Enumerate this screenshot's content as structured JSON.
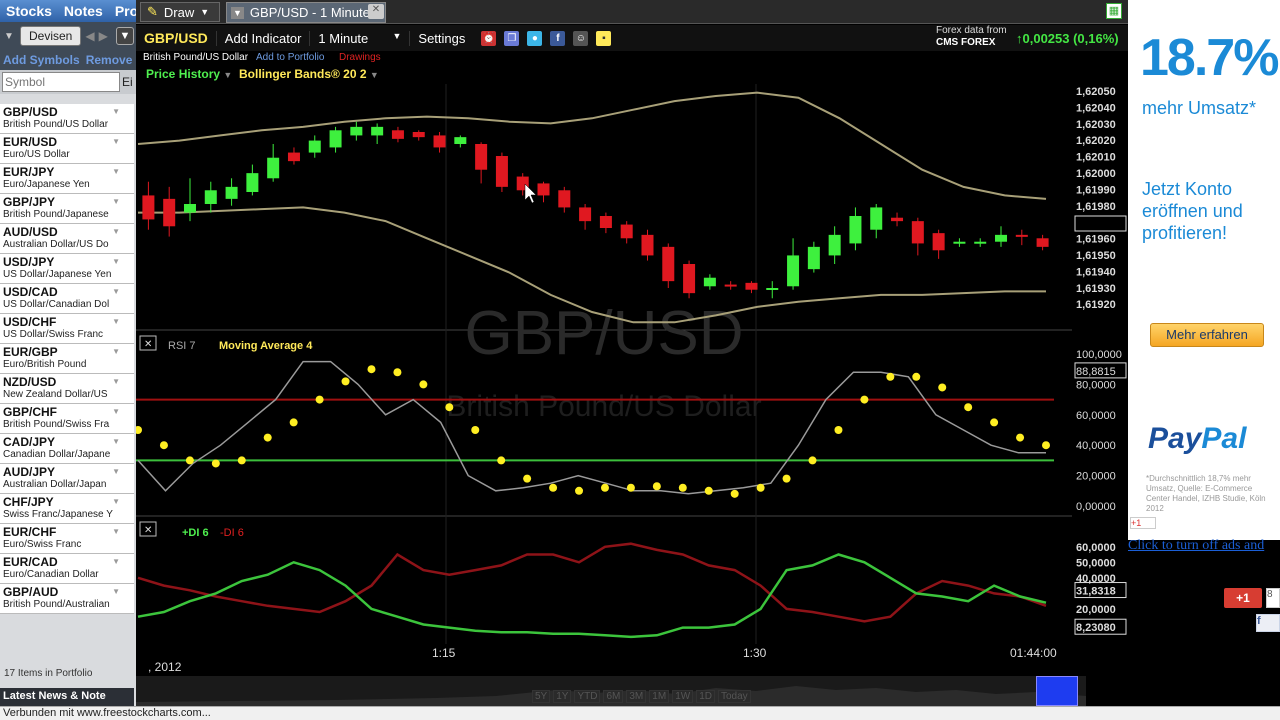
{
  "sidebar": {
    "tabs": [
      "Stocks",
      "Notes",
      "Prof"
    ],
    "devisen_label": "Devisen",
    "add_symbols": "Add Symbols",
    "remove": "Remove",
    "symbol_placeholder": "Symbol",
    "symbol_ed": "Ei",
    "items": [
      {
        "code": "GBP/USD",
        "name": "British Pound/US Dollar"
      },
      {
        "code": "EUR/USD",
        "name": "Euro/US Dollar"
      },
      {
        "code": "EUR/JPY",
        "name": "Euro/Japanese Yen"
      },
      {
        "code": "GBP/JPY",
        "name": "British Pound/Japanese"
      },
      {
        "code": "AUD/USD",
        "name": "Australian Dollar/US Do"
      },
      {
        "code": "USD/JPY",
        "name": "US Dollar/Japanese Yen"
      },
      {
        "code": "USD/CAD",
        "name": "US Dollar/Canadian Dol"
      },
      {
        "code": "USD/CHF",
        "name": "US Dollar/Swiss Franc"
      },
      {
        "code": "EUR/GBP",
        "name": "Euro/British Pound"
      },
      {
        "code": "NZD/USD",
        "name": "New Zealand Dollar/US"
      },
      {
        "code": "GBP/CHF",
        "name": "British Pound/Swiss Fra"
      },
      {
        "code": "CAD/JPY",
        "name": "Canadian Dollar/Japane"
      },
      {
        "code": "AUD/JPY",
        "name": "Australian Dollar/Japan"
      },
      {
        "code": "CHF/JPY",
        "name": "Swiss Franc/Japanese Y"
      },
      {
        "code": "EUR/CHF",
        "name": "Euro/Swiss Franc"
      },
      {
        "code": "EUR/CAD",
        "name": "Euro/Canadian Dollar"
      },
      {
        "code": "GBP/AUD",
        "name": "British Pound/Australian"
      }
    ],
    "items_count": "17 Items in Portfolio",
    "latest_news": "Latest News & Note"
  },
  "topbar": {
    "draw": "Draw",
    "tab_title": "GBP/USD - 1 Minute"
  },
  "toolbar": {
    "symbol": "GBP/USD",
    "add_indicator": "Add Indicator",
    "interval": "1 Minute",
    "settings": "Settings",
    "forex_data": "Forex data from",
    "cms_forex": "CMS FOREX",
    "change": "0,00253 (0,16%)"
  },
  "subtitle": {
    "name": "British Pound/US Dollar",
    "add_portfolio": "Add to Portfolio",
    "drawings": "Drawings"
  },
  "indicators": {
    "price_history": "Price History",
    "bollinger": "Bollinger Bands® 20 2",
    "rsi": "RSI 7",
    "moving_avg": "Moving Average 4",
    "di_plus": "+DI 6",
    "di_minus": "-DI 6"
  },
  "watermark": {
    "symbol": "GBP/USD",
    "name": "British Pound/US Dollar"
  },
  "price_axis": [
    "1,62050",
    "1,62040",
    "1,62030",
    "1,62020",
    "1,62010",
    "1,62000",
    "1,61990",
    "1,61980",
    "1,61970",
    "1,61960",
    "1,61950",
    "1,61940",
    "1,61930",
    "1,61920"
  ],
  "rsi_axis": [
    "100,0000",
    "88,8815",
    "80,0000",
    "60,0000",
    "40,0000",
    "20,0000",
    "0,00000"
  ],
  "di_axis": [
    "60,0000",
    "50,0000",
    "40,0000",
    "31,8318",
    "20,0000",
    "8,23080"
  ],
  "time_axis": [
    "1:15",
    "1:30",
    "01:44:00"
  ],
  "date_label": ", 2012",
  "range_buttons": [
    "5Y",
    "1Y",
    "YTD",
    "6M",
    "3M",
    "1M",
    "1W",
    "1D",
    "Today"
  ],
  "ad": {
    "percent": "18.7%",
    "mehr": "mehr Umsatz*",
    "konto": "Jetzt Konto eröffnen und profitieren!",
    "button": "Mehr erfahren",
    "paypal_a": "Pay",
    "paypal_b": "Pal",
    "fine": "*Durchschnittlich 18,7% mehr Umsatz, Quelle: E-Commerce Center Handel, IZHB Studie, Köln 2012",
    "turn_off": "Click to turn off ads and"
  },
  "social": {
    "gplus_small": "+1",
    "gplus": "+1",
    "gplus_count": "8",
    "fb": "f"
  },
  "status": "Verbunden mit www.freestockcharts.com...",
  "chart_data": {
    "type": "line",
    "candles": [
      {
        "o": 1.61976,
        "c": 1.6199,
        "h": 1.61998,
        "l": 1.6197,
        "up": false
      },
      {
        "o": 1.61972,
        "c": 1.61988,
        "h": 1.61995,
        "l": 1.61966,
        "up": false
      },
      {
        "o": 1.61985,
        "c": 1.6198,
        "h": 1.62,
        "l": 1.61975,
        "up": true
      },
      {
        "o": 1.61985,
        "c": 1.61993,
        "h": 1.61998,
        "l": 1.6198,
        "up": true
      },
      {
        "o": 1.61988,
        "c": 1.61995,
        "h": 1.62,
        "l": 1.61984,
        "up": true
      },
      {
        "o": 1.61992,
        "c": 1.62003,
        "h": 1.62008,
        "l": 1.6199,
        "up": true
      },
      {
        "o": 1.62,
        "c": 1.62012,
        "h": 1.6202,
        "l": 1.61998,
        "up": true
      },
      {
        "o": 1.62015,
        "c": 1.6201,
        "h": 1.62018,
        "l": 1.62008,
        "up": false
      },
      {
        "o": 1.62015,
        "c": 1.62022,
        "h": 1.62025,
        "l": 1.62012,
        "up": true
      },
      {
        "o": 1.62018,
        "c": 1.62028,
        "h": 1.6203,
        "l": 1.62015,
        "up": true
      },
      {
        "o": 1.62025,
        "c": 1.6203,
        "h": 1.62033,
        "l": 1.62022,
        "up": true
      },
      {
        "o": 1.62025,
        "c": 1.6203,
        "h": 1.62032,
        "l": 1.6202,
        "up": true
      },
      {
        "o": 1.62028,
        "c": 1.62023,
        "h": 1.6203,
        "l": 1.62021,
        "up": false
      },
      {
        "o": 1.62027,
        "c": 1.62024,
        "h": 1.62028,
        "l": 1.62022,
        "up": false
      },
      {
        "o": 1.62025,
        "c": 1.62018,
        "h": 1.62027,
        "l": 1.62015,
        "up": false
      },
      {
        "o": 1.6202,
        "c": 1.62024,
        "h": 1.62025,
        "l": 1.62018,
        "up": true
      },
      {
        "o": 1.6202,
        "c": 1.62005,
        "h": 1.62021,
        "l": 1.61997,
        "up": false
      },
      {
        "o": 1.62013,
        "c": 1.61995,
        "h": 1.62015,
        "l": 1.61992,
        "up": false
      },
      {
        "o": 1.62001,
        "c": 1.61993,
        "h": 1.62003,
        "l": 1.6199,
        "up": false
      },
      {
        "o": 1.61997,
        "c": 1.6199,
        "h": 1.61998,
        "l": 1.61986,
        "up": false
      },
      {
        "o": 1.61993,
        "c": 1.61983,
        "h": 1.61995,
        "l": 1.6198,
        "up": false
      },
      {
        "o": 1.61983,
        "c": 1.61975,
        "h": 1.61985,
        "l": 1.6197,
        "up": false
      },
      {
        "o": 1.61978,
        "c": 1.61971,
        "h": 1.6198,
        "l": 1.61968,
        "up": false
      },
      {
        "o": 1.61973,
        "c": 1.61965,
        "h": 1.61975,
        "l": 1.61962,
        "up": false
      },
      {
        "o": 1.61967,
        "c": 1.61955,
        "h": 1.6197,
        "l": 1.61952,
        "up": false
      },
      {
        "o": 1.6196,
        "c": 1.6194,
        "h": 1.61962,
        "l": 1.61936,
        "up": false
      },
      {
        "o": 1.6195,
        "c": 1.61933,
        "h": 1.61952,
        "l": 1.6193,
        "up": false
      },
      {
        "o": 1.61937,
        "c": 1.61942,
        "h": 1.61944,
        "l": 1.61935,
        "up": true
      },
      {
        "o": 1.61938,
        "c": 1.61937,
        "h": 1.6194,
        "l": 1.61935,
        "up": false
      },
      {
        "o": 1.61939,
        "c": 1.61935,
        "h": 1.6194,
        "l": 1.61933,
        "up": false
      },
      {
        "o": 1.61935,
        "c": 1.61936,
        "h": 1.6194,
        "l": 1.6193,
        "up": true
      },
      {
        "o": 1.61937,
        "c": 1.61955,
        "h": 1.61965,
        "l": 1.61935,
        "up": true
      },
      {
        "o": 1.61947,
        "c": 1.6196,
        "h": 1.61963,
        "l": 1.61945,
        "up": true
      },
      {
        "o": 1.61955,
        "c": 1.61967,
        "h": 1.61972,
        "l": 1.6195,
        "up": true
      },
      {
        "o": 1.61962,
        "c": 1.61978,
        "h": 1.61983,
        "l": 1.61958,
        "up": true
      },
      {
        "o": 1.6197,
        "c": 1.61983,
        "h": 1.61985,
        "l": 1.61965,
        "up": true
      },
      {
        "o": 1.61977,
        "c": 1.61975,
        "h": 1.6198,
        "l": 1.61972,
        "up": false
      },
      {
        "o": 1.61975,
        "c": 1.61962,
        "h": 1.61977,
        "l": 1.61955,
        "up": false
      },
      {
        "o": 1.61968,
        "c": 1.61958,
        "h": 1.6197,
        "l": 1.61953,
        "up": false
      },
      {
        "o": 1.61962,
        "c": 1.61963,
        "h": 1.61965,
        "l": 1.6196,
        "up": true
      },
      {
        "o": 1.61962,
        "c": 1.61963,
        "h": 1.61965,
        "l": 1.6196,
        "up": true
      },
      {
        "o": 1.61963,
        "c": 1.61967,
        "h": 1.61972,
        "l": 1.6196,
        "up": true
      },
      {
        "o": 1.61967,
        "c": 1.61966,
        "h": 1.6197,
        "l": 1.61961,
        "up": false
      },
      {
        "o": 1.61965,
        "c": 1.6196,
        "h": 1.61967,
        "l": 1.61958,
        "up": false
      }
    ],
    "bollinger_upper": [
      1.6202,
      1.62022,
      1.62025,
      1.62028,
      1.6203,
      1.62033,
      1.62035,
      1.62036,
      1.62035,
      1.62033,
      1.62032,
      1.62035,
      1.6204,
      1.62045,
      1.62048,
      1.6205,
      1.62047,
      1.62035,
      1.6202,
      1.62005,
      1.61995,
      1.6199,
      1.61988
    ],
    "bollinger_lower": [
      1.6198,
      1.6198,
      1.61981,
      1.61982,
      1.61983,
      1.6198,
      1.61975,
      1.61965,
      1.61955,
      1.61945,
      1.61932,
      1.61922,
      1.61916,
      1.61916,
      1.6192,
      1.61925,
      1.61928,
      1.6193,
      1.61932,
      1.61932,
      1.61933,
      1.61934,
      1.61934
    ],
    "rsi": [
      30,
      10,
      28,
      40,
      55,
      70,
      95,
      95,
      80,
      60,
      70,
      55,
      20,
      10,
      12,
      15,
      20,
      15,
      10,
      10,
      8,
      10,
      12,
      15,
      40,
      70,
      88,
      88,
      85,
      60,
      50,
      40,
      35,
      35
    ],
    "rsi_ma": [
      50,
      40,
      30,
      28,
      30,
      45,
      55,
      70,
      82,
      90,
      88,
      80,
      65,
      50,
      30,
      18,
      12,
      10,
      12,
      12,
      13,
      12,
      10,
      8,
      12,
      18,
      30,
      50,
      70,
      85,
      85,
      78,
      65,
      55,
      45,
      40
    ],
    "rsi_overbought": 70,
    "rsi_oversold": 30,
    "di_plus": [
      15,
      18,
      25,
      30,
      38,
      42,
      50,
      45,
      35,
      20,
      15,
      10,
      8,
      6,
      5,
      5,
      4,
      4,
      3,
      2,
      3,
      8,
      8,
      10,
      20,
      45,
      48,
      55,
      50,
      40,
      30,
      28,
      25,
      35,
      28,
      24
    ],
    "di_minus": [
      40,
      35,
      32,
      28,
      25,
      22,
      20,
      18,
      25,
      35,
      55,
      45,
      42,
      45,
      48,
      55,
      55,
      50,
      60,
      62,
      58,
      55,
      48,
      45,
      35,
      20,
      18,
      15,
      12,
      15,
      30,
      38,
      35,
      30,
      28,
      22
    ]
  }
}
